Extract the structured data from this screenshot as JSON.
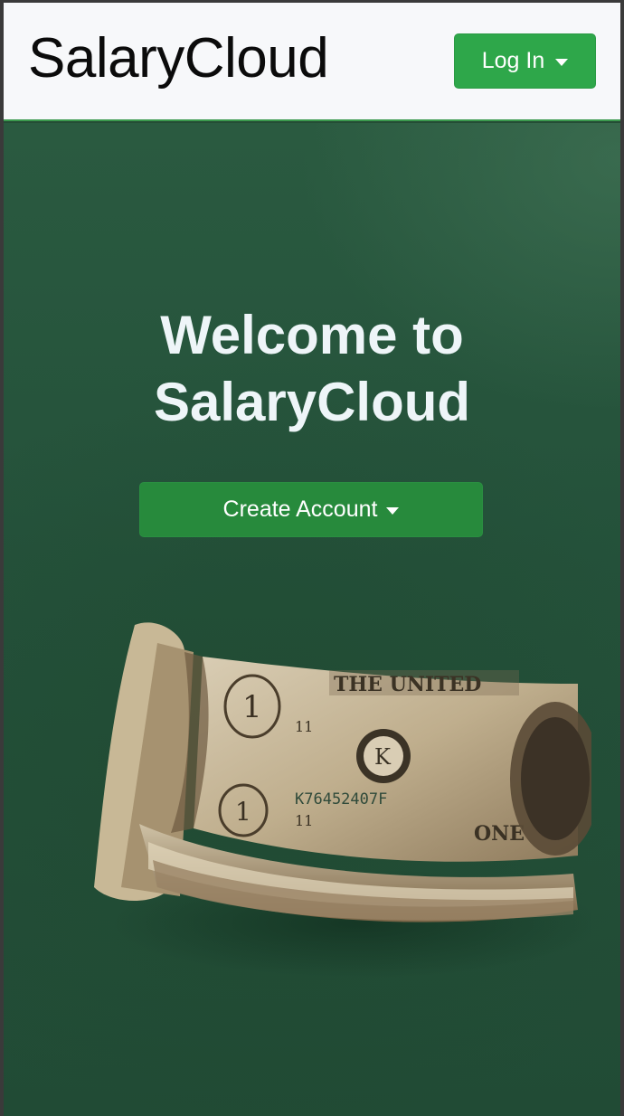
{
  "navbar": {
    "brand": "SalaryCloud",
    "login_label": "Log In"
  },
  "hero": {
    "headline_line1": "Welcome to",
    "headline_line2": "SalaryCloud",
    "create_label": "Create Account"
  },
  "colors": {
    "navbar_bg": "#f7f8fa",
    "hero_bg": "#24513a",
    "primary_button": "#2ea74a",
    "headline_text": "#eef5f8"
  },
  "icons": {
    "login_dropdown": "caret-down-icon",
    "create_dropdown": "caret-down-icon"
  }
}
